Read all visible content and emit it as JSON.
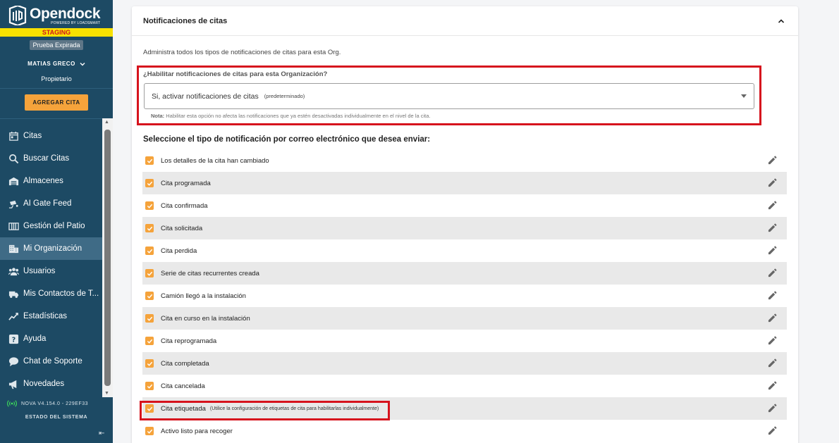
{
  "brand": {
    "name": "Opendock",
    "tagline": "POWERED BY LOADSMART",
    "env_badge": "STAGING",
    "trial_badge": "Prueba Expirada"
  },
  "user": {
    "name": "MATIAS GRECO",
    "role": "Propietario"
  },
  "add_button": "AGREGAR CITA",
  "nav": [
    {
      "label": "Citas",
      "icon": "calendar-icon",
      "active": false
    },
    {
      "label": "Buscar Citas",
      "icon": "search-icon",
      "active": false
    },
    {
      "label": "Almacenes",
      "icon": "warehouse-icon",
      "active": false
    },
    {
      "label": "AI Gate Feed",
      "icon": "camera-icon",
      "active": false
    },
    {
      "label": "Gestión del Patio",
      "icon": "yard-icon",
      "active": false
    },
    {
      "label": "Mi Organización",
      "icon": "building-icon",
      "active": true
    },
    {
      "label": "Usuarios",
      "icon": "users-icon",
      "active": false
    },
    {
      "label": "Mis Contactos de T...",
      "icon": "truck-icon",
      "active": false
    },
    {
      "label": "Estadísticas",
      "icon": "chart-icon",
      "active": false
    },
    {
      "label": "Ayuda",
      "icon": "help-icon",
      "active": false
    },
    {
      "label": "Chat de Soporte",
      "icon": "chat-icon",
      "active": false
    },
    {
      "label": "Novedades",
      "icon": "megaphone-icon",
      "active": false
    }
  ],
  "footer": {
    "version": "NOVA V4.154.0 - 229EF33",
    "status": "ESTADO DEL SISTEMA"
  },
  "panel": {
    "title": "Notificaciones de citas",
    "description": "Administra todos los tipos de notificaciones de citas para esta Org.",
    "question": "¿Habilitar notificaciones de citas para esta Organización?",
    "select_value": "Si, activar notificaciones de citas",
    "select_hint": "(predeterminado)",
    "note_prefix": "Nota:",
    "note_text": "Habilitar esta opción no afecta las notificaciones que ya estén desactivadas individualmente en el nivel de la cita.",
    "section_heading": "Seleccione el tipo de notificación por correo electrónico que desea enviar:"
  },
  "notifications": [
    {
      "label": "Los detalles de la cita han cambiado",
      "hint": ""
    },
    {
      "label": "Cita programada",
      "hint": ""
    },
    {
      "label": "Cita confirmada",
      "hint": ""
    },
    {
      "label": "Cita solicitada",
      "hint": ""
    },
    {
      "label": "Cita perdida",
      "hint": ""
    },
    {
      "label": "Serie de citas recurrentes creada",
      "hint": ""
    },
    {
      "label": "Camión llegó a la instalación",
      "hint": ""
    },
    {
      "label": "Cita en curso en la instalación",
      "hint": ""
    },
    {
      "label": "Cita reprogramada",
      "hint": ""
    },
    {
      "label": "Cita completada",
      "hint": ""
    },
    {
      "label": "Cita cancelada",
      "hint": ""
    },
    {
      "label": "Cita etiquetada",
      "hint": "(Utilice la configuración de etiquetas de cita para habilitarlas individualmente)"
    },
    {
      "label": "Activo listo para recoger",
      "hint": ""
    }
  ],
  "colors": {
    "sidebar": "#1d4a64",
    "accent": "#f5a33b",
    "highlight": "#d6131d"
  }
}
